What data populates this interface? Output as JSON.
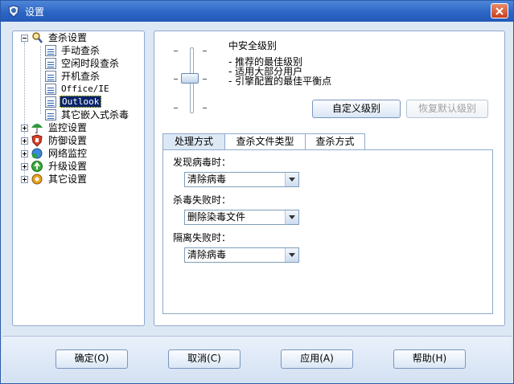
{
  "window": {
    "title": "设置"
  },
  "tree": {
    "root": "查杀设置",
    "children": [
      "手动查杀",
      "空闲时段查杀",
      "开机查杀",
      "Office/IE",
      "Outlook",
      "其它嵌入式杀毒"
    ],
    "categories": [
      "监控设置",
      "防御设置",
      "网络监控",
      "升级设置",
      "其它设置"
    ]
  },
  "level": {
    "title": "中安全级别",
    "description": [
      "- 推荐的最佳级别",
      "- 适用大部分用户",
      "- 引擎配置的最佳平衡点"
    ],
    "custom_button": "自定义级别",
    "restore_button": "恢复默认级别"
  },
  "tabs": [
    "处理方式",
    "查杀文件类型",
    "查杀方式"
  ],
  "form": {
    "found_label": "发现病毒时：",
    "found_value": "清除病毒",
    "fail_label": "杀毒失败时：",
    "fail_value": "删除染毒文件",
    "isolate_label": "隔离失败时：",
    "isolate_value": "清除病毒"
  },
  "buttons": {
    "ok": "确定(O)",
    "cancel": "取消(C)",
    "apply": "应用(A)",
    "help": "帮助(H)"
  },
  "colors": {
    "titlebar": "#2a64c4",
    "window_bg": "#dde8f5",
    "selection": "#0a246a"
  }
}
